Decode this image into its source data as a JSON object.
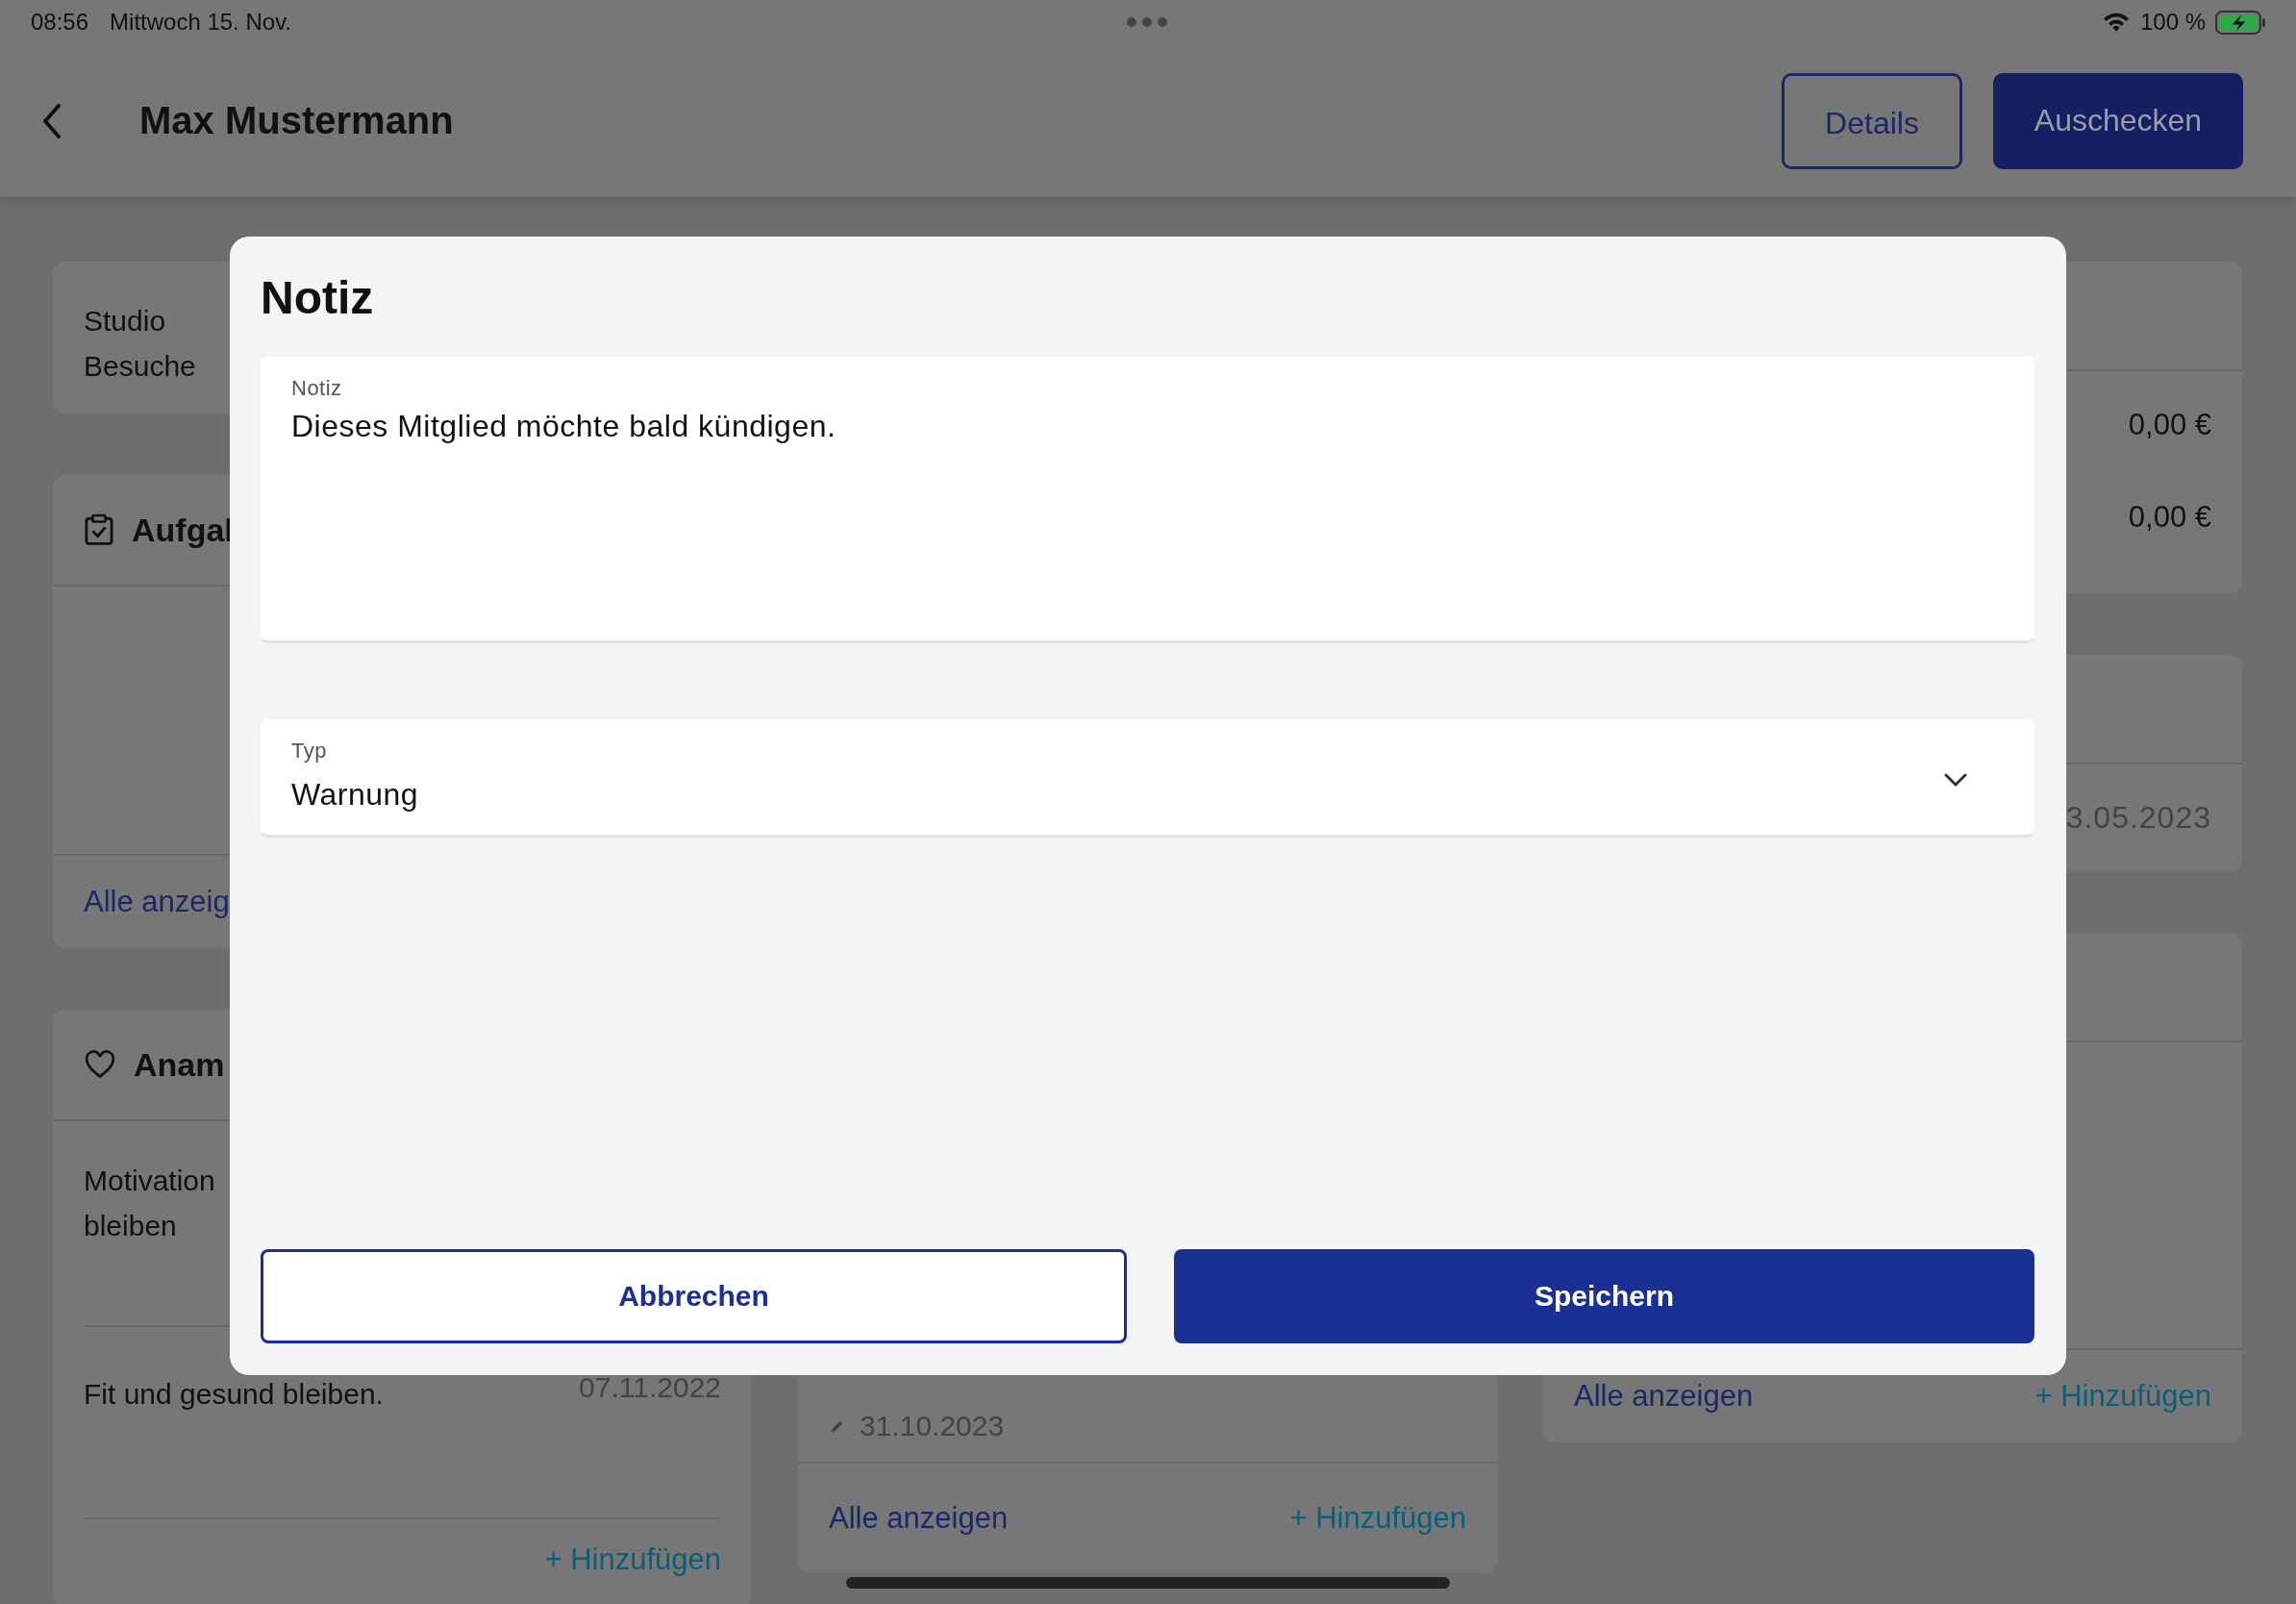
{
  "status_bar": {
    "time": "08:56",
    "date": "Mittwoch 15. Nov.",
    "battery": "100 %"
  },
  "header": {
    "title": "Max Mustermann",
    "buttons": [
      {
        "label": "Details",
        "kind": "outline"
      },
      {
        "label": "Auschecken",
        "kind": "filled"
      }
    ]
  },
  "left_column": {
    "visits_label": "Studio Besuche",
    "tasks": {
      "title": "Aufgal",
      "footer_link": "Alle anzeig"
    },
    "anamnesis": {
      "title": "Anam",
      "rows": [
        {
          "text": "Motivation bleiben"
        },
        {
          "text": "Fit und gesund bleiben.",
          "date": "07.11.2022"
        }
      ],
      "add_link": "+ Hinzufügen"
    }
  },
  "middle_column": {
    "row_date": "31.10.2023",
    "footer_links": [
      "Alle anzeigen",
      "+ Hinzufügen"
    ]
  },
  "right_column": {
    "amounts": [
      "0,00 €",
      "0,00 €"
    ],
    "date": "3.05.2023",
    "footer_links": [
      "Alle anzeigen",
      "+ Hinzufügen"
    ]
  },
  "dialog": {
    "title": "Notiz",
    "fields": [
      {
        "kind": "textarea",
        "label": "Notiz",
        "value": "Dieses Mitglied möchte bald kündigen."
      },
      {
        "kind": "select",
        "label": "Typ",
        "value": "Warnung"
      }
    ],
    "buttons": [
      {
        "label": "Abbrechen",
        "kind": "outline"
      },
      {
        "label": "Speichern",
        "kind": "filled"
      }
    ]
  }
}
